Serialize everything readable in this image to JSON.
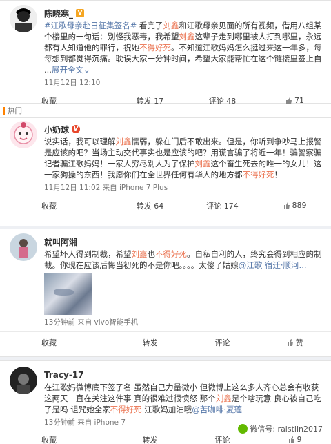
{
  "posts": [
    {
      "username": "陈晓寒_",
      "vip_badge": "V",
      "text_parts": [
        {
          "t": "#江歌母亲赴日征集签名#",
          "c": "link"
        },
        {
          "t": " 看完了",
          "c": "plain"
        },
        {
          "t": "刘鑫",
          "c": "hl"
        },
        {
          "t": "和江歌母亲见面的所有视频，借用八组某个楼里的一句话：别怪我恶毒，我希望",
          "c": "plain"
        },
        {
          "t": "刘鑫",
          "c": "hl"
        },
        {
          "t": "这辈子走到哪里被人打到哪里，永远都有人知道他的罪行，祝她",
          "c": "plain"
        },
        {
          "t": "不得好死",
          "c": "hl"
        },
        {
          "t": "。",
          "c": "plain"
        },
        {
          "t": "不知道江歌妈妈怎么挺过来这一年多，每每想到都觉得沉痛。耽误大家一分钟时间，希望大家能帮忙在这个链接里签上自 ...",
          "c": "plain"
        },
        {
          "t": "展开全文",
          "c": "link"
        },
        {
          "t": "⌄",
          "c": "link"
        }
      ],
      "meta": "11月12日 12:10",
      "actions": {
        "repost": "收藏",
        "forward": "转发 17",
        "comment": "评论 48",
        "like": "71"
      }
    },
    {
      "section_label": "热门",
      "username": "小奶球",
      "vip_badge": "V",
      "text_parts": [
        {
          "t": "说实话，我可以理解",
          "c": "plain"
        },
        {
          "t": "刘鑫",
          "c": "hl"
        },
        {
          "t": "懦弱，躲在门后不敢出来。但是，你听到争吵马上报警是应该的吧？当场主动交代事实也是应该的吧？用谎言骗了将近一年！骗警察骗记者骗江歌妈妈！一家人穷尽别人为了保护",
          "c": "plain"
        },
        {
          "t": "刘鑫",
          "c": "hl"
        },
        {
          "t": "这个畜生死去的唯一的女儿！这一家狗操的东西！我愿你们在全世界任何有华人的地方都",
          "c": "plain"
        },
        {
          "t": "不得好死",
          "c": "hl"
        },
        {
          "t": "！",
          "c": "plain"
        }
      ],
      "meta": "11月12日 11:02  来自 iPhone 7 Plus",
      "actions": {
        "repost": "收藏",
        "forward": "转发 64",
        "comment": "评论 174",
        "like": "889"
      }
    },
    {
      "username": "就叫阿湘",
      "text_parts": [
        {
          "t": "希望坏人得到制裁，希望",
          "c": "plain"
        },
        {
          "t": "刘鑫",
          "c": "hl"
        },
        {
          "t": "也",
          "c": "plain"
        },
        {
          "t": "不得好死",
          "c": "hl"
        },
        {
          "t": "。自私自利的人，终究会得到相应的制裁。你现在应该后悔当初死的不是你吧。。。。太傻了姑娘",
          "c": "plain"
        },
        {
          "t": "@江歌",
          "c": "link"
        },
        {
          "t": " 宿迁·顺河...",
          "c": "link"
        }
      ],
      "meta": "13分钟前  来自 vivo智能手机",
      "actions": {
        "repost": "收藏",
        "forward": "转发",
        "comment": "评论",
        "like": "赞"
      }
    },
    {
      "username": "Tracy-17",
      "text_parts": [
        {
          "t": "在江歌妈微博底下签了名 虽然自己力量微小 但微博上这么多人齐心总会有收获 这两天一直在关注这件事 真的很难过很愤怒 那个",
          "c": "plain"
        },
        {
          "t": "刘鑫",
          "c": "hl"
        },
        {
          "t": "是个啥玩意 良心被自己吃了是吗 诅咒她全家",
          "c": "plain"
        },
        {
          "t": "不得好死",
          "c": "hl"
        },
        {
          "t": " 江歌妈加油哦",
          "c": "plain"
        },
        {
          "t": "@苦咖啡·夏莲",
          "c": "link"
        }
      ],
      "meta": "13分钟前  来自 iPhone 7",
      "actions": {
        "repost": "收藏",
        "forward": "转发",
        "comment": "评论",
        "like": "9"
      }
    }
  ],
  "watermark": "微信号: raistlin2017",
  "colors": {
    "highlight": "#eb7350",
    "link": "#5476a8",
    "hot_accent": "#ff8200"
  }
}
